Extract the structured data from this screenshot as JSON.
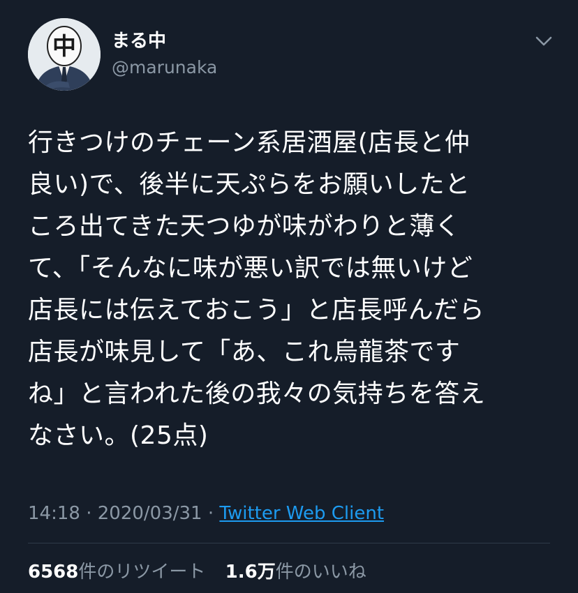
{
  "author": {
    "display_name": "まる中",
    "handle": "@marunaka",
    "avatar_badge_char": "中"
  },
  "tweet": {
    "lines": [
      "行きつけのチェーン系居酒屋(店長と仲",
      "良い)で、後半に天ぷらをお願いしたと",
      "ころ出てきた天つゆが味がわりと薄く",
      "て、「そんなに味が悪い訳では無いけど",
      "店長には伝えておこう」と店長呼んだら",
      "店長が味見して「あ、これ烏龍茶です",
      "ね」と言われた後の我々の気持ちを答え",
      "なさい。(25点)"
    ]
  },
  "meta": {
    "time": "14:18",
    "separator": "·",
    "date": "2020/03/31",
    "client": "Twitter Web Client"
  },
  "stats": {
    "retweets_count": "6568",
    "retweets_label": "件のリツイート",
    "likes_count": "1.6万",
    "likes_label": "件のいいね"
  },
  "icons": {
    "menu": "chevron-down-icon"
  },
  "colors": {
    "background": "#151d29",
    "text_primary": "#ffffff",
    "text_secondary": "#8b98a5",
    "link": "#1d9bf0",
    "divider": "#2f3b48"
  }
}
